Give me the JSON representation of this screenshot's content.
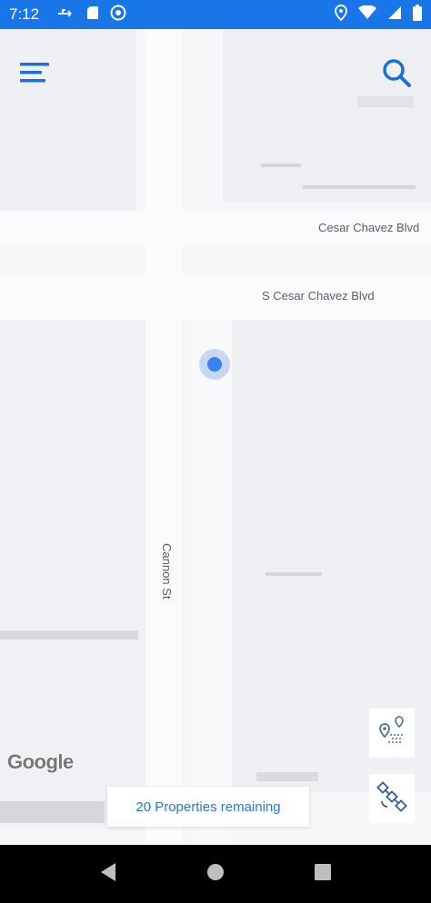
{
  "status_bar": {
    "time": "7:12",
    "left_icons": [
      "usb-icon",
      "sd-card-icon",
      "vpn-icon"
    ],
    "right_icons": [
      "location-pin-icon",
      "wifi-icon",
      "signal-icon",
      "battery-icon"
    ]
  },
  "map": {
    "street_labels": {
      "cesar_chavez_blvd": "Cesar Chavez Blvd",
      "s_cesar_chavez_blvd": "S Cesar Chavez Blvd",
      "cannon_st": "Cannon St"
    },
    "logo": "Google",
    "controls": {
      "menu_icon": "hamburger-menu-icon",
      "search_icon": "search-icon",
      "map_layer_icon": "map-pin-layer-icon",
      "satellite_icon": "satellite-icon"
    }
  },
  "properties": {
    "label": "20 Properties remaining"
  },
  "nav_bar": {
    "back": "back-icon",
    "home": "home-icon",
    "recents": "recents-icon"
  },
  "colors": {
    "status_bar": "#1976e8",
    "accent": "#2a78d6",
    "location_dot": "#3b82f0"
  }
}
